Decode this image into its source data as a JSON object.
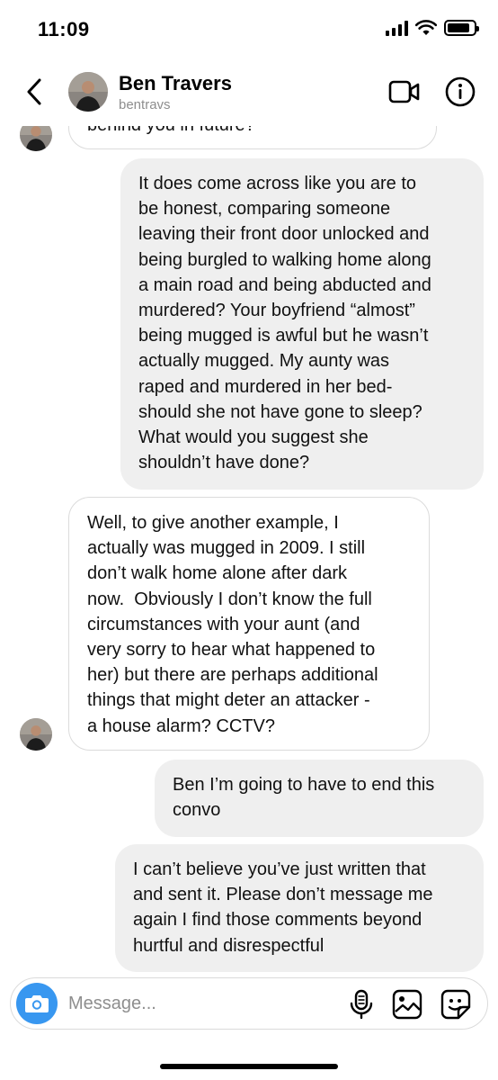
{
  "status_bar": {
    "time": "11:09",
    "battery_level": 0.85
  },
  "header": {
    "name": "Ben Travers",
    "username": "bentravs",
    "icons": [
      "back-chevron-icon",
      "video-call-icon",
      "info-icon"
    ]
  },
  "messages": [
    {
      "direction": "incoming",
      "lines": [
        "behind you in future?"
      ],
      "partially_visible": true
    },
    {
      "direction": "outgoing",
      "lines": [
        "It does come across like you are to",
        "be honest, comparing someone",
        "leaving their front door unlocked and",
        "being burgled to walking home along",
        "a main road and being abducted and",
        "murdered? Your boyfriend “almost”",
        "being mugged is awful but he wasn’t",
        "actually mugged. My aunty was",
        "raped and murdered in her bed-",
        "should she not have gone to sleep?",
        "What would you suggest she",
        "shouldn’t have done?"
      ]
    },
    {
      "direction": "incoming",
      "lines": [
        "Well, to give another example, I",
        "actually was mugged in 2009. I still",
        "don’t walk home alone after dark",
        "now.  Obviously I don’t know the full",
        "circumstances with your aunt (and",
        "very sorry to hear what happened to",
        "her) but there are perhaps additional",
        "things that might deter an attacker -",
        "a house alarm? CCTV?"
      ]
    },
    {
      "direction": "outgoing",
      "lines": [
        "Ben I’m going to have to end this",
        "convo"
      ]
    },
    {
      "direction": "outgoing",
      "lines": [
        "I can’t believe you’ve just written that",
        "and sent it. Please don’t message me",
        "again I find those comments beyond",
        "hurtful and disrespectful"
      ]
    }
  ],
  "composer": {
    "placeholder": "Message...",
    "value": "",
    "icons": [
      "camera-icon",
      "microphone-icon",
      "gallery-icon",
      "sticker-icon"
    ]
  },
  "colors": {
    "accent": "#3897f0",
    "outgoing_bubble": "#efefef",
    "incoming_border": "#dbdbdb",
    "secondary_text": "#8e8e8e"
  }
}
